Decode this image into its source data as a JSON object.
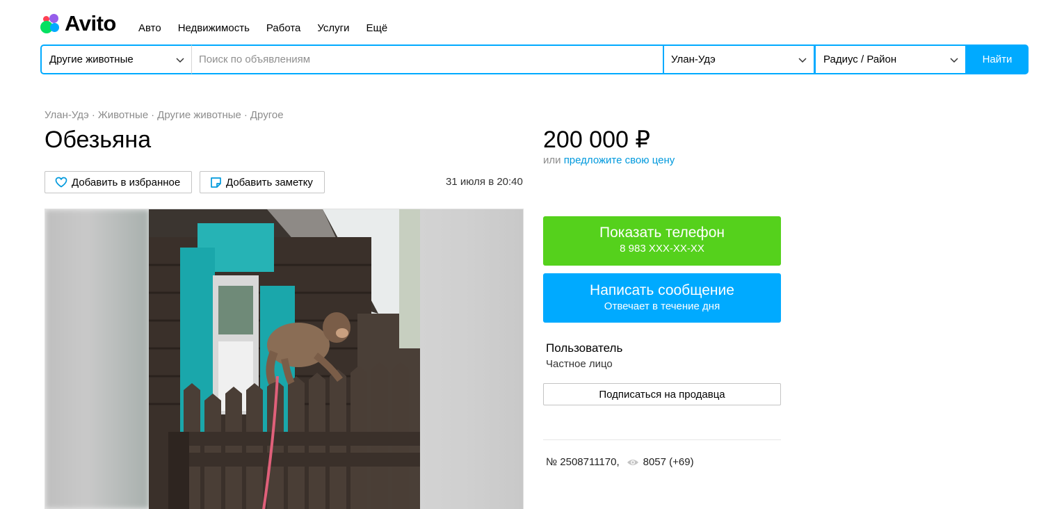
{
  "header": {
    "logo_text": "Avito",
    "nav": [
      "Авто",
      "Недвижимость",
      "Работа",
      "Услуги",
      "Ещё"
    ]
  },
  "search": {
    "category": "Другие животные",
    "placeholder": "Поиск по объявлениям",
    "city": "Улан-Удэ",
    "radius": "Радиус / Район",
    "button": "Найти"
  },
  "breadcrumb": [
    "Улан-Удэ",
    "Животные",
    "Другие животные",
    "Другое"
  ],
  "listing": {
    "title": "Обезьяна",
    "price": "200 000 ₽",
    "price_prefix": "или",
    "price_link": "предложите свою цену",
    "add_favorite": "Добавить в избранное",
    "add_note": "Добавить заметку",
    "date": "31 июля в 20:40",
    "id_text": "№ 2508711170,",
    "views": "8057 (+69)"
  },
  "contact": {
    "phone_title": "Показать телефон",
    "phone_masked": "8 983 XXX-XX-XX",
    "message_title": "Написать сообщение",
    "message_sub": "Отвечает в течение дня"
  },
  "seller": {
    "name": "Пользователь",
    "type": "Частное лицо",
    "subscribe": "Подписаться на продавца"
  },
  "colors": {
    "accent": "#00aaff",
    "phone_button": "#55d11c",
    "link": "#0099dd"
  }
}
